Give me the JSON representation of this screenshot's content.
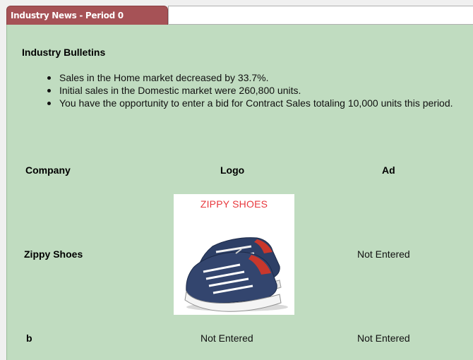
{
  "tab": {
    "label": "Industry News - Period 0"
  },
  "bulletins": {
    "title": "Industry Bulletins",
    "items": [
      "Sales in the Home market decreased by 33.7%.",
      "Initial sales in the Domestic market were 260,800 units.",
      "You have the opportunity to enter a bid for Contract Sales totaling 10,000 units this period."
    ]
  },
  "table": {
    "headers": {
      "company": "Company",
      "logo": "Logo",
      "ad": "Ad"
    },
    "rows": [
      {
        "company": "Zippy Shoes",
        "logo_text": "ZIPPY SHOES",
        "ad": "Not Entered"
      },
      {
        "company": "b",
        "logo": "Not Entered",
        "ad": "Not Entered"
      }
    ]
  },
  "colors": {
    "tab": "#a65256",
    "panel": "#c0dcc0",
    "logo_text": "#e8383d"
  },
  "icons": {
    "logo_image": "sneakers-icon"
  }
}
